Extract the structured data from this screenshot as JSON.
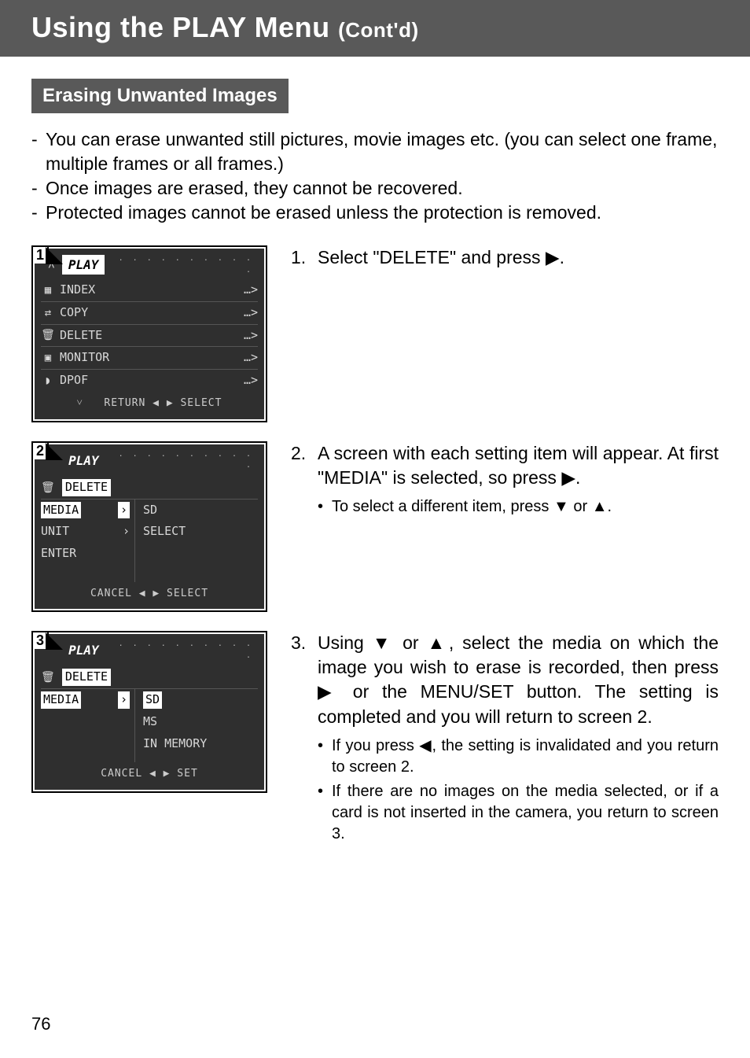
{
  "header": {
    "title": "Using the PLAY Menu",
    "subtitle": "(Cont'd)"
  },
  "section_heading": "Erasing Unwanted Images",
  "intro": {
    "line1": "You can erase unwanted still pictures, movie images etc. (you can select one frame, multiple frames or all frames.)",
    "line2": "Once images are erased, they cannot be recovered.",
    "line3": "Protected images cannot be erased unless the protection is removed."
  },
  "glyph": {
    "right": "▶",
    "left": "◀",
    "up": "▲",
    "down": "▼",
    "dots_arrow": "…>"
  },
  "lcd_common": {
    "play": "PLAY",
    "dot_strip": ". . . . . . . . . . ."
  },
  "screen1": {
    "number": "1",
    "items": {
      "index": "INDEX",
      "copy": "COPY",
      "delete": "DELETE",
      "monitor": "MONITOR",
      "dpof": "DPOF"
    },
    "footer": "RETURN ◀   ▶ SELECT"
  },
  "step1": {
    "num": "1.",
    "text_a": "Select \"DELETE\" and press ",
    "text_b": "."
  },
  "screen2": {
    "number": "2",
    "sub": "DELETE",
    "rows": {
      "media": {
        "label": "MEDIA",
        "value": "SD"
      },
      "unit": {
        "label": "UNIT",
        "value": "SELECT"
      },
      "enter": {
        "label": "ENTER"
      }
    },
    "footer": "CANCEL ◀   ▶ SELECT"
  },
  "step2": {
    "num": "2.",
    "line1_a": "A screen with each setting item will appear. At first \"MEDIA\" is selected, so press ",
    "line1_b": ".",
    "bullet_a": "To select a different item, press ",
    "bullet_mid": " or ",
    "bullet_b": "."
  },
  "screen3": {
    "number": "3",
    "sub": "DELETE",
    "row_label": "MEDIA",
    "options": {
      "sd": "SD",
      "ms": "MS",
      "inmem": "IN MEMORY"
    },
    "footer": "CANCEL ◀   ▶ SET"
  },
  "step3": {
    "num": "3.",
    "body_a": "Using ",
    "body_mid1": " or ",
    "body_b": ", select the media on which the image you wish to erase is recorded, then press ",
    "body_c": " or the MENU/SET button. The setting is completed and you will return to screen 2.",
    "bullet1_a": "If you press ",
    "bullet1_b": ", the setting is invalidated and you return to screen 2.",
    "bullet2": "If there are no images on the media selected, or if a card is not inserted in the camera, you return to screen 3."
  },
  "page_number": "76"
}
